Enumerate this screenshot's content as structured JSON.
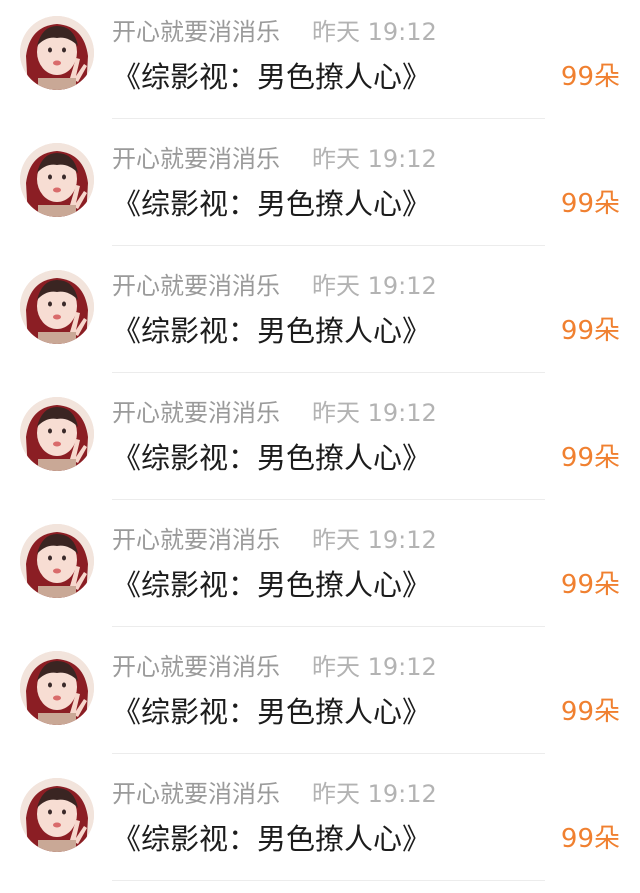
{
  "items": [
    {
      "username": "开心就要消消乐",
      "time": "昨天 19:12",
      "message": "《综影视：男色撩人心》",
      "count": "99朵"
    },
    {
      "username": "开心就要消消乐",
      "time": "昨天 19:12",
      "message": "《综影视：男色撩人心》",
      "count": "99朵"
    },
    {
      "username": "开心就要消消乐",
      "time": "昨天 19:12",
      "message": "《综影视：男色撩人心》",
      "count": "99朵"
    },
    {
      "username": "开心就要消消乐",
      "time": "昨天 19:12",
      "message": "《综影视：男色撩人心》",
      "count": "99朵"
    },
    {
      "username": "开心就要消消乐",
      "time": "昨天 19:12",
      "message": "《综影视：男色撩人心》",
      "count": "99朵"
    },
    {
      "username": "开心就要消消乐",
      "time": "昨天 19:12",
      "message": "《综影视：男色撩人心》",
      "count": "99朵"
    },
    {
      "username": "开心就要消消乐",
      "time": "昨天 19:12",
      "message": "《综影视：男色撩人心》",
      "count": "99朵"
    }
  ],
  "colors": {
    "count": "#f08030",
    "username": "#9a9a9a",
    "time": "#b3b3b3",
    "message": "#1c1c1c"
  }
}
